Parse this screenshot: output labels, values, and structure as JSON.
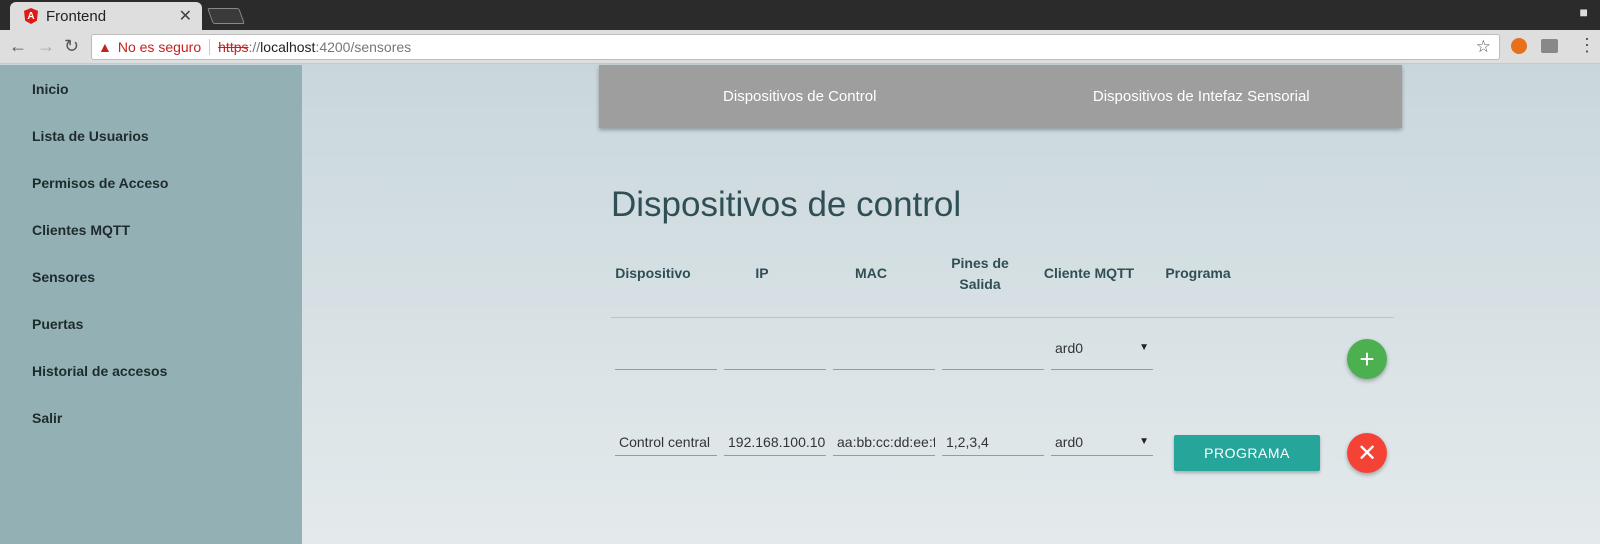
{
  "browser": {
    "tab_title": "Frontend",
    "security_label": "No es seguro",
    "url_scheme": "https",
    "url_sep": "://",
    "url_host": "localhost",
    "url_rest": ":4200/sensores"
  },
  "sidebar": {
    "items": [
      {
        "label": "Inicio"
      },
      {
        "label": "Lista de Usuarios"
      },
      {
        "label": "Permisos de Acceso"
      },
      {
        "label": "Clientes MQTT"
      },
      {
        "label": "Sensores"
      },
      {
        "label": "Puertas"
      },
      {
        "label": "Historial de accesos"
      },
      {
        "label": "Salir"
      }
    ]
  },
  "topnav": {
    "items": [
      {
        "label": "Dispositivos de Control"
      },
      {
        "label": "Dispositivos de Intefaz Sensorial"
      }
    ]
  },
  "main": {
    "title": "Dispositivos de control",
    "columns": [
      "Dispositivo",
      "IP",
      "MAC",
      "Pines de Salida",
      "Cliente MQTT",
      "Programa"
    ],
    "new_row": {
      "dispositivo": "",
      "ip": "",
      "mac": "",
      "pines": "",
      "cliente": "ard0"
    },
    "rows": [
      {
        "dispositivo": "Control central",
        "ip": "192.168.100.10",
        "mac": "aa:bb:cc:dd:ee:ff",
        "pines": "1,2,3,4",
        "cliente": "ard0",
        "programa_label": "PROGRAMA"
      }
    ]
  },
  "icons": {
    "add": "plus-icon",
    "delete": "close-icon"
  },
  "colors": {
    "sidebar": "#93b1b5",
    "topnav": "#9e9e9e",
    "programa_button": "#26a69a",
    "add_button": "#4caf50",
    "delete_button": "#f44336"
  }
}
